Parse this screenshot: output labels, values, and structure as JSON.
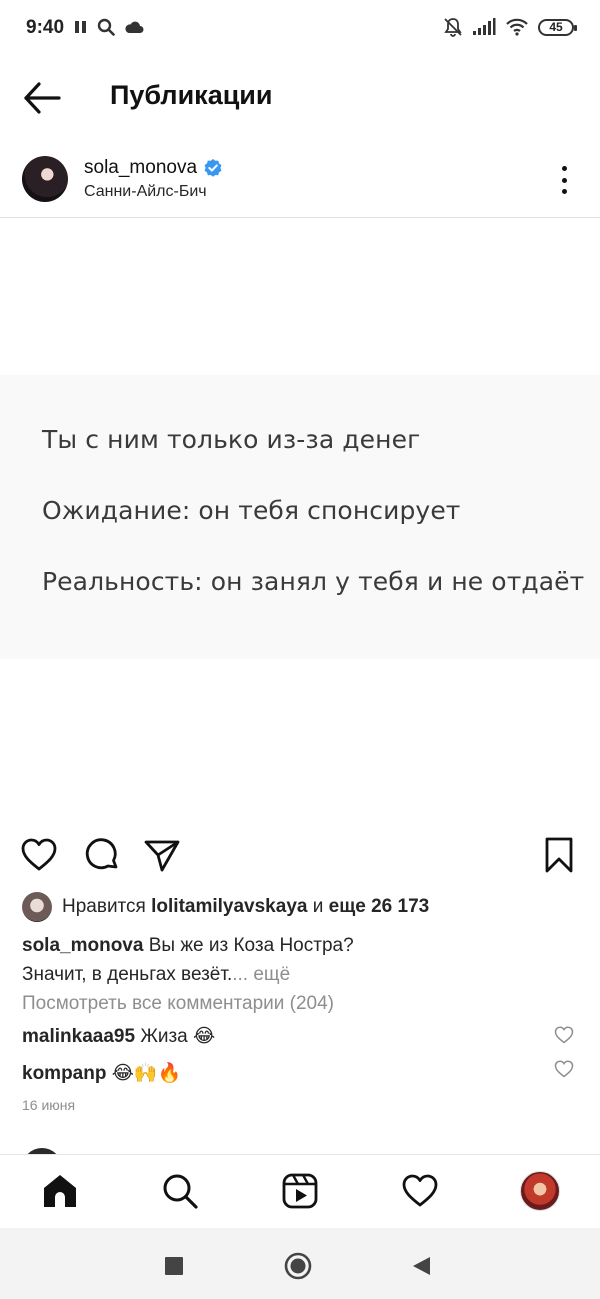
{
  "status_bar": {
    "time": "9:40",
    "battery": "45",
    "left_icons": [
      "pause-icon",
      "search-icon",
      "cloud-icon"
    ],
    "right_icons": [
      "muted-bell-icon",
      "signal-icon",
      "wifi-icon",
      "battery-icon"
    ]
  },
  "header": {
    "title": "Публикации",
    "back_icon": "arrow-left-icon"
  },
  "post": {
    "username": "sola_monova",
    "location": "Санни-Айлс-Бич",
    "image_text": {
      "line1": "Ты с ним только из-за денег",
      "line2": "Ожидание: он тебя спонсирует",
      "line3": "Реальность: он занял у тебя и не отдаёт"
    },
    "likes": {
      "prefix": "Нравится",
      "user": "lolitamilyavskaya",
      "middle": "и",
      "rest": "еще 26 173"
    },
    "caption": {
      "username": "sola_monova",
      "text_line1": "Вы же из Коза Ностра?",
      "text_line2": "Значит, в деньгах везёт.",
      "more": "... ещё"
    },
    "view_comments": "Посмотреть все комментарии (204)",
    "comments": [
      {
        "username": "malinkaaa95",
        "text": "Жиза 😂"
      },
      {
        "username": "kompanp",
        "text": "😂🙌🔥"
      }
    ],
    "date": "16 июня"
  },
  "colors": {
    "text": "#262626",
    "secondary": "#8e8e8e",
    "verified": "#3897f0",
    "post_bg": "#f9f9f9"
  }
}
